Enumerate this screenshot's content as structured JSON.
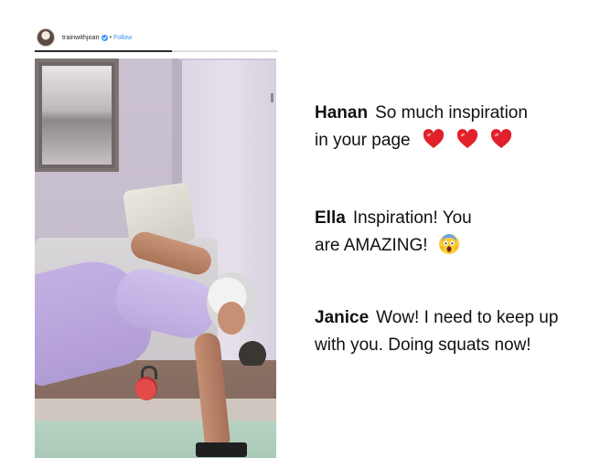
{
  "post": {
    "username": "trainwithjoan",
    "separator": "•",
    "follow_label": "Follow",
    "verified": true,
    "accent_color": "#3897f0"
  },
  "comments": [
    {
      "author": "Hanan",
      "text_line1": "So much inspiration",
      "text_line2": "in your page",
      "emojis": [
        "red-heart-icon",
        "red-heart-icon",
        "red-heart-icon"
      ]
    },
    {
      "author": "Ella",
      "text_line1": "Inspiration! You",
      "text_line2": "are AMAZING!",
      "emojis": [
        "face-screaming-in-fear-icon"
      ]
    },
    {
      "author": "Janice",
      "text_line1": "Wow! I need to keep up",
      "text_line2": "with you. Doing squats now!",
      "emojis": []
    }
  ],
  "colors": {
    "heart": "#e0202a",
    "text": "#111111",
    "background": "#ffffff"
  }
}
